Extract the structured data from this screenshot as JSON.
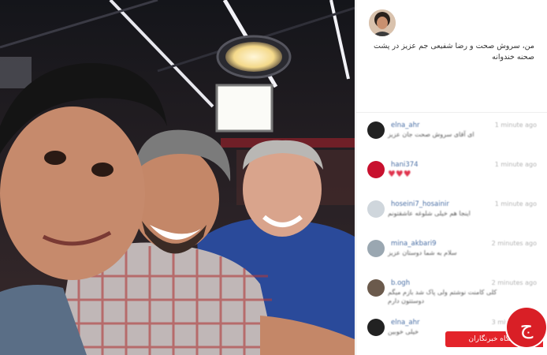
{
  "post": {
    "caption": "من، سروش صحت و رضا شفیعی جم عزیز در پشت صحنه خندوانه"
  },
  "comments": [
    {
      "user": "elna_ahr",
      "time": "1 minute ago",
      "text": "ای آقای سروش صحت جان عزیز",
      "avatar_color": "#222222",
      "red": false
    },
    {
      "user": "hani374",
      "time": "1 minute ago",
      "text": "♥♥♥",
      "avatar_color": "#c8102e",
      "red": true
    },
    {
      "user": "hoseini7_hosainir",
      "time": "1 minute ago",
      "text": "اینجا هم خیلی شلوغه عاشقتونم",
      "avatar_color": "#cfd6dc",
      "red": false
    },
    {
      "user": "mina_akbari9",
      "time": "2 minutes ago",
      "text": "سلام به شما دوستان عزیز",
      "avatar_color": "#9aa7b1",
      "red": false
    },
    {
      "user": "b.ogh",
      "time": "2 minutes ago",
      "text": "کلی کامنت نوشتم ولی پاک شد بازم میگم دوستتون دارم",
      "avatar_color": "#6b5a4c",
      "red": false
    },
    {
      "user": "elna_ahr",
      "time": "3 minutes ago",
      "text": "خیلی خوبین",
      "avatar_color": "#222222",
      "red": false
    }
  ],
  "watermark": {
    "label": "باشگاه خبرنگاران",
    "logo_char": "ج"
  },
  "colors": {
    "accent_red": "#e3232a",
    "username_blue": "#4a6fa5"
  }
}
